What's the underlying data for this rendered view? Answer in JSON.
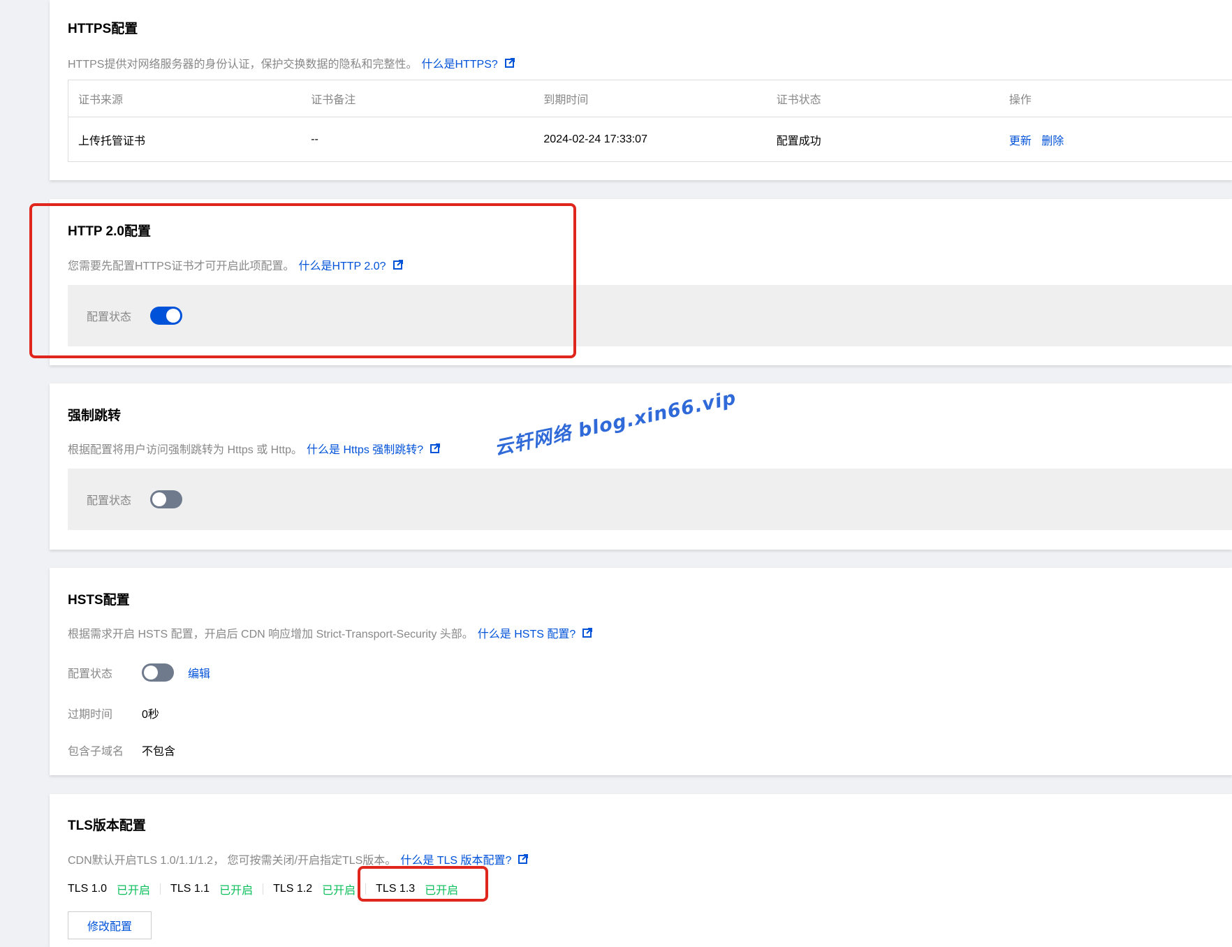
{
  "https": {
    "title": "HTTPS配置",
    "desc": "HTTPS提供对网络服务器的身份认证，保护交换数据的隐私和完整性。",
    "link": "什么是HTTPS?",
    "columns": [
      "证书来源",
      "证书备注",
      "到期时间",
      "证书状态",
      "操作"
    ],
    "row": {
      "source": "上传托管证书",
      "note": "--",
      "expire": "2024-02-24 17:33:07",
      "status": "配置成功",
      "op_update": "更新",
      "op_delete": "删除"
    }
  },
  "http2": {
    "title": "HTTP 2.0配置",
    "desc": "您需要先配置HTTPS证书才可开启此项配置。",
    "link": "什么是HTTP 2.0?",
    "status_label": "配置状态",
    "enabled": true
  },
  "force_redirect": {
    "title": "强制跳转",
    "desc": "根据配置将用户访问强制跳转为 Https 或 Http。",
    "link": "什么是 Https 强制跳转?",
    "status_label": "配置状态",
    "enabled": false
  },
  "hsts": {
    "title": "HSTS配置",
    "desc": "根据需求开启 HSTS 配置，开启后 CDN 响应增加 Strict-Transport-Security 头部。",
    "link": "什么是 HSTS 配置?",
    "status_label": "配置状态",
    "enabled": false,
    "edit_label": "编辑",
    "expire_label": "过期时间",
    "expire_value": "0秒",
    "subdomain_label": "包含子域名",
    "subdomain_value": "不包含"
  },
  "tls": {
    "title": "TLS版本配置",
    "desc": "CDN默认开启TLS 1.0/1.1/1.2， 您可按需关闭/开启指定TLS版本。",
    "link": "什么是 TLS 版本配置?",
    "versions": [
      {
        "version": "TLS 1.0",
        "status": "已开启"
      },
      {
        "version": "TLS 1.1",
        "status": "已开启"
      },
      {
        "version": "TLS 1.2",
        "status": "已开启"
      },
      {
        "version": "TLS 1.3",
        "status": "已开启"
      }
    ],
    "modify_button": "修改配置"
  },
  "watermark": "云轩网络  blog.xin66.vip",
  "colors": {
    "link": "#0052d9",
    "enabled_status": "#0abf5b",
    "highlight": "#e0261c",
    "toggle_on": "#0052d9",
    "toggle_off": "#6f7a8c"
  }
}
